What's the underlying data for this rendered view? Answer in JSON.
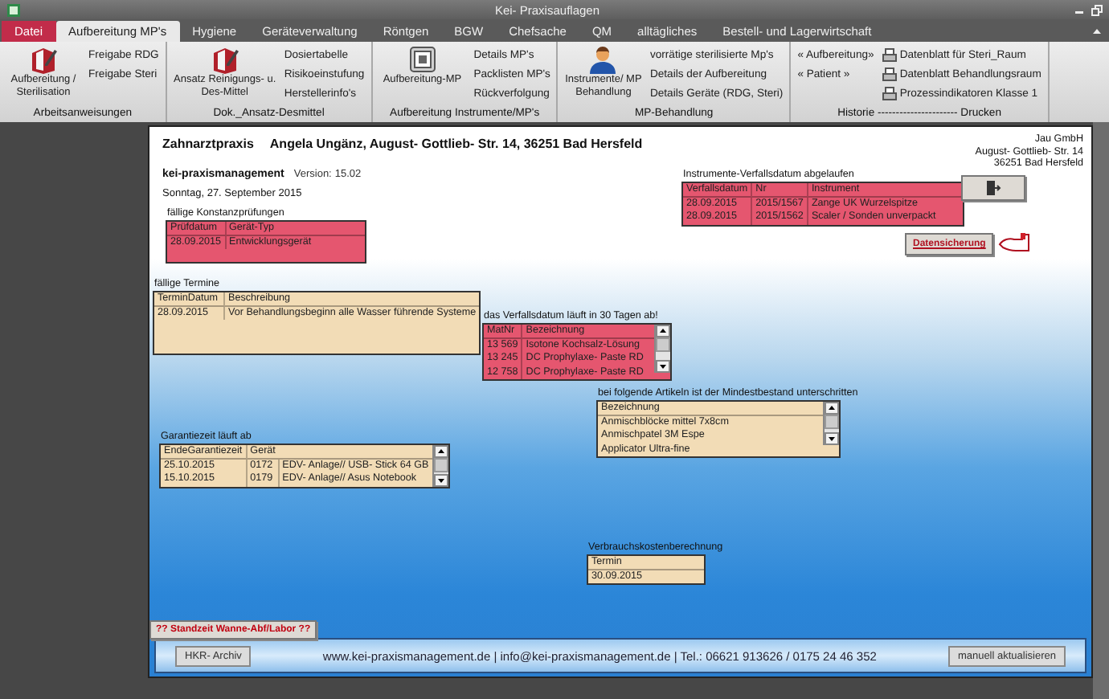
{
  "window": {
    "title": "Kei- Praxisauflagen"
  },
  "tabs": [
    {
      "label": "Datei",
      "kind": "file",
      "selected": false
    },
    {
      "label": "Aufbereitung MP's",
      "kind": "tab",
      "selected": true
    },
    {
      "label": "Hygiene",
      "kind": "tab",
      "selected": false
    },
    {
      "label": "Geräteverwaltung",
      "kind": "tab",
      "selected": false
    },
    {
      "label": "Röntgen",
      "kind": "tab",
      "selected": false
    },
    {
      "label": "BGW",
      "kind": "tab",
      "selected": false
    },
    {
      "label": "Chefsache",
      "kind": "tab",
      "selected": false
    },
    {
      "label": "QM",
      "kind": "tab",
      "selected": false
    },
    {
      "label": "alltägliches",
      "kind": "tab",
      "selected": false
    },
    {
      "label": "Bestell- und Lagerwirtschaft",
      "kind": "tab",
      "selected": false
    }
  ],
  "ribbon_groups": [
    {
      "label": "Arbeitsanweisungen",
      "items": [
        {
          "kind": "large",
          "label": "Aufbereitung / Sterilisation"
        },
        {
          "kind": "small",
          "label": "Freigabe RDG"
        },
        {
          "kind": "small",
          "label": "Freigabe Steri"
        }
      ]
    },
    {
      "label": "Dok._Ansatz-Desmittel",
      "items": [
        {
          "kind": "large",
          "label": "Ansatz Reinigungs- u. Des-Mittel"
        },
        {
          "kind": "small",
          "label": "Dosiertabelle"
        },
        {
          "kind": "small",
          "label": "Risikoeinstufung"
        },
        {
          "kind": "small",
          "label": "Herstellerinfo's"
        }
      ]
    },
    {
      "label": "Aufbereitung Instrumente/MP's",
      "items": [
        {
          "kind": "large",
          "label": "Aufbereitung-MP"
        },
        {
          "kind": "small",
          "label": "Details MP's"
        },
        {
          "kind": "small",
          "label": "Packlisten MP's"
        },
        {
          "kind": "small",
          "label": "Rückverfolgung"
        }
      ]
    },
    {
      "label": "MP-Behandlung",
      "items": [
        {
          "kind": "large",
          "label": "Instrumente/ MP Behandlung"
        },
        {
          "kind": "small",
          "label": "vorrätige sterilisierte Mp's"
        },
        {
          "kind": "small",
          "label": "Details der Aufbereitung"
        },
        {
          "kind": "small",
          "label": "Details Geräte (RDG, Steri)"
        }
      ]
    },
    {
      "label": "Historie ---------------------- Drucken",
      "items": [
        {
          "kind": "small",
          "label": "« Aufbereitung»"
        },
        {
          "kind": "small",
          "label": "« Patient »"
        },
        {
          "kind": "print",
          "label": "Datenblatt für Steri_Raum"
        },
        {
          "kind": "print",
          "label": "Datenblatt Behandlungsraum"
        },
        {
          "kind": "print",
          "label": "Prozessindikatoren Klasse 1"
        }
      ]
    }
  ],
  "form": {
    "practice_type": "Zahnarztpraxis",
    "practice_address": "Angela Ungänz, August- Gottlieb- Str. 14, 36251 Bad Hersfeld",
    "app_name": "kei-praxismanagement",
    "version_label": "Version:",
    "version": "15.02",
    "date": "Sonntag, 27. September 2015",
    "company_lines": [
      "Jau GmbH",
      "August- Gottlieb- Str. 14",
      "36251 Bad Hersfeld"
    ],
    "panels": [
      {
        "title": "fällige Konstanzprüfungen",
        "color": "#e5566f",
        "scrollbar": false,
        "columns": [
          "Prüfdatum",
          "Gerät-Typ"
        ],
        "rows": [
          [
            "28.09.2015",
            "Entwicklungsgerät"
          ]
        ]
      },
      {
        "title": "fällige Termine",
        "color": "#f2dcb6",
        "scrollbar": false,
        "columns": [
          "TerminDatum",
          "Beschreibung"
        ],
        "rows": [
          [
            "28.09.2015",
            "Vor Behandlungsbeginn alle Wasser führende Systeme"
          ]
        ]
      },
      {
        "title": "Instrumente-Verfallsdatum abgelaufen",
        "color": "#e5566f",
        "scrollbar": false,
        "columns": [
          "Verfallsdatum",
          "Nr",
          "Instrument"
        ],
        "rows": [
          [
            "28.09.2015",
            "2015/1567",
            "Zange UK Wurzelspitze"
          ],
          [
            "28.09.2015",
            "2015/1562",
            "Scaler / Sonden unverpackt"
          ]
        ]
      },
      {
        "title": "das Verfallsdatum läuft in 30 Tagen ab!",
        "color": "#e5566f",
        "scrollbar": true,
        "columns": [
          "MatNr",
          "Bezeichnung"
        ],
        "rows": [
          [
            "13 569",
            "Isotone Kochsalz-Lösung"
          ],
          [
            "13 245",
            "DC Prophylaxe- Paste RD"
          ],
          [
            "12 758",
            "DC Prophylaxe- Paste RD"
          ]
        ]
      },
      {
        "title": "bei folgende Artikeln ist der Mindestbestand unterschritten",
        "color": "#f2dcb6",
        "scrollbar": true,
        "columns": [
          "Bezeichnung"
        ],
        "rows": [
          [
            "Anmischblöcke mittel 7x8cm"
          ],
          [
            "Anmischpatel 3M Espe"
          ],
          [
            "Applicator Ultra-fine"
          ]
        ]
      },
      {
        "title": "Garantiezeit läuft ab",
        "color": "#f2dcb6",
        "scrollbar": true,
        "columns": [
          "EndeGarantiezeit",
          "Gerät"
        ],
        "rows": [
          [
            "25.10.2015",
            "0172",
            "EDV- Anlage// USB- Stick 64 GB"
          ],
          [
            "15.10.2015",
            "0179",
            "EDV- Anlage// Asus Notebook"
          ]
        ]
      },
      {
        "title": "Verbrauchskostenberechnung",
        "color": "#f2dcb6",
        "scrollbar": false,
        "columns": [
          "Termin"
        ],
        "rows": [
          [
            "30.09.2015"
          ]
        ]
      }
    ],
    "backup_button": "Datensicherung",
    "standzeit_button": "?? Standzeit Wanne-Abf/Labor ??",
    "footer": {
      "archive_button": "HKR- Archiv",
      "contact": "www.kei-praxismanagement.de | info@kei-praxismanagement.de | Tel.: 06621 913626 / 0175 24 46 352",
      "refresh_button": "manuell aktualisieren"
    }
  }
}
